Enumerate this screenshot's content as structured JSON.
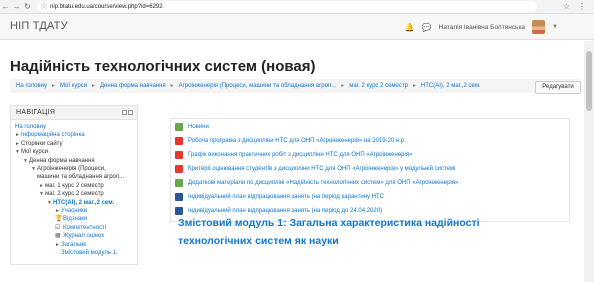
{
  "browser": {
    "back": "←",
    "forward": "→",
    "reload": "↻",
    "url": "nip.btatu.edu.ua/course/view.php?id=6292"
  },
  "header": {
    "brand": "НІП ТДАТУ",
    "user_name": "Наталія Іванівна Болтянська"
  },
  "page": {
    "title": "Надійність технологічних систем (новая)",
    "edit_button": "Редагувати"
  },
  "breadcrumb": [
    "На головну",
    "Мої курси",
    "Денна форма навчання",
    "Агроінженерія (Процеси, машини та обладнання агроп...",
    "маг. 2 курс 2 семестр",
    "НТС(АІ), 2 маг.,2 сем."
  ],
  "navigation": {
    "title": "НАВІГАЦІЯ",
    "items": [
      "На головну",
      "Інформаційна сторінка",
      "Сторінки сайту",
      "Мої курси",
      "Денна форма навчання",
      "Агроінженерія (Процеси,",
      "машини та обладнання агроп...",
      "маг. 1 курс 2 семестр",
      "маг. 2 курс 2 семестр",
      "НТС(АІ), 2 маг.,2 сем.",
      "Учасники",
      "Відзнаки",
      "Компетентності",
      "Журнал оцінок",
      "Загальне",
      "Змістовий модуль 1:"
    ]
  },
  "activities": [
    "Новини",
    "Робоча програма з дисципліни НТС для ОНП «Агроінженерія» на 2019-20 н.р.",
    "Графік виконання практичних робіт з дисципліни НТС для ОНП «Агроінженерія»",
    "Критерії оцінювання студентів з дисципліни НТС для ОНП «Агроінженерія» у модульній системі",
    "Додаткові матеріали по дисципліні «Надійність технологічних систем» для ОНП «Агроінженерія»",
    "Індивідуальний план відпрацювання занять (на період карантину НТС",
    "Індивідуальний план відпрацювання занять (на період до 24.04.2020)"
  ],
  "section": {
    "title": "Змістовий модуль 1: Загальна характеристика надійності технологічних систем як науки"
  }
}
